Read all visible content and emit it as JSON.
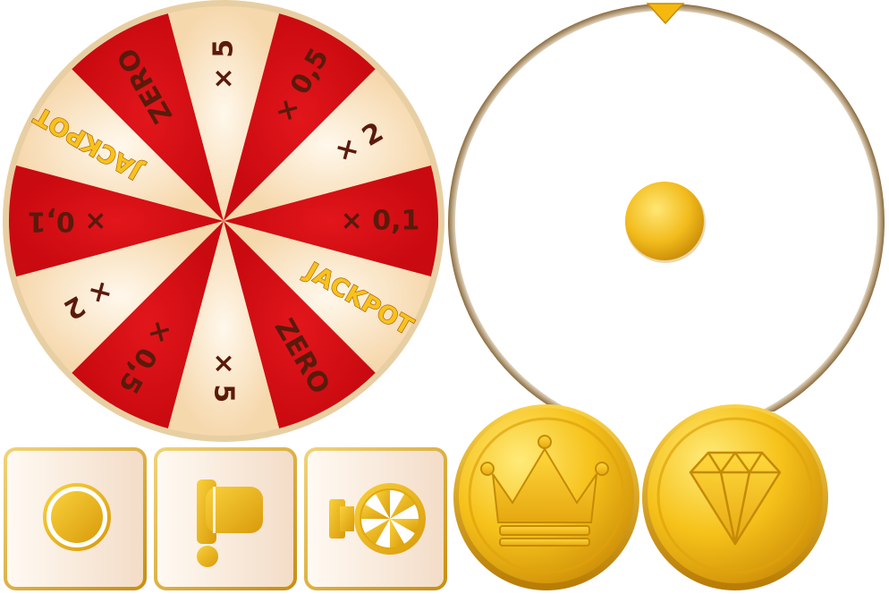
{
  "wheel": {
    "colors": {
      "red": "#d60d12",
      "cream": "#fde8c9",
      "text_dark": "#5a1a0c",
      "text_gold": "#f7c21c",
      "rim": "#d9b97f"
    },
    "segments": [
      {
        "label": "× 0,1",
        "color": "red",
        "text": "dark"
      },
      {
        "label": "JACKPOT",
        "color": "cream",
        "text": "gold"
      },
      {
        "label": "ZERO",
        "color": "red",
        "text": "dark"
      },
      {
        "label": "× 5",
        "color": "cream",
        "text": "dark"
      },
      {
        "label": "× 0,5",
        "color": "red",
        "text": "dark"
      },
      {
        "label": "× 2",
        "color": "cream",
        "text": "dark"
      },
      {
        "label": "× 0,1",
        "color": "red",
        "text": "dark"
      },
      {
        "label": "JACKPOT",
        "color": "cream",
        "text": "gold"
      },
      {
        "label": "ZERO",
        "color": "red",
        "text": "dark"
      },
      {
        "label": "× 5",
        "color": "cream",
        "text": "dark"
      },
      {
        "label": "× 0,5",
        "color": "red",
        "text": "dark"
      },
      {
        "label": "× 2",
        "color": "cream",
        "text": "dark"
      }
    ]
  },
  "ring": {
    "pointer_icon": "triangle-pointer-icon",
    "hub_icon": "gold-hub-icon"
  },
  "buttons": [
    {
      "name": "coin-button",
      "icon": "coin-icon"
    },
    {
      "name": "lever-button",
      "icon": "lever-icon"
    },
    {
      "name": "spin-button",
      "icon": "spin-wheel-icon"
    }
  ],
  "coins": [
    {
      "name": "crown-coin",
      "icon": "crown-icon"
    },
    {
      "name": "diamond-coin",
      "icon": "diamond-icon"
    }
  ],
  "palette": {
    "gold_light": "#ffe774",
    "gold": "#f5c216",
    "gold_dark": "#c88a06",
    "button_bg": "#fbf1e6",
    "button_border": "#d5a52c"
  }
}
